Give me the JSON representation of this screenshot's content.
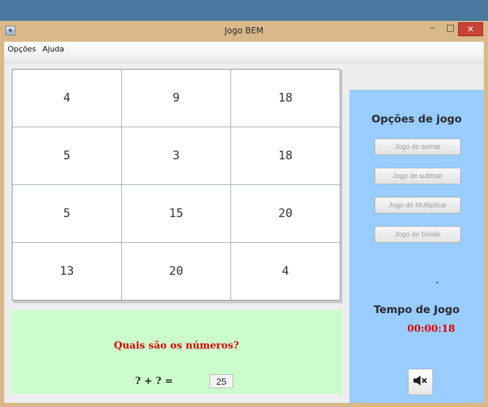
{
  "window": {
    "title": "Jogo BEM",
    "minimize_glyph": "–",
    "maximize_glyph": "□",
    "close_glyph": "✕",
    "app_icon_glyph": "◈"
  },
  "menu": {
    "items": [
      "Opções",
      "Ajuda"
    ]
  },
  "grid": {
    "rows": [
      [
        "4",
        "9",
        "18"
      ],
      [
        "5",
        "3",
        "18"
      ],
      [
        "5",
        "15",
        "20"
      ],
      [
        "13",
        "20",
        "4"
      ]
    ]
  },
  "question": {
    "text": "Quais são os números?",
    "equation": "? + ? =",
    "target": "25"
  },
  "side": {
    "title": "Opções de jogo",
    "buttons": [
      "Jogo de somar",
      "Jogo de subtrair",
      "Jogo de Multiplicar",
      "Jogo de Dividir"
    ],
    "time_title": "Tempo de Jogo",
    "timer": "00:00:18",
    "sound_icon": "speaker-muted-icon"
  },
  "colors": {
    "question_panel": "#ccfccc",
    "side_panel": "#99ccff",
    "accent_red": "#e00000",
    "window_frame": "#d9b88a"
  }
}
